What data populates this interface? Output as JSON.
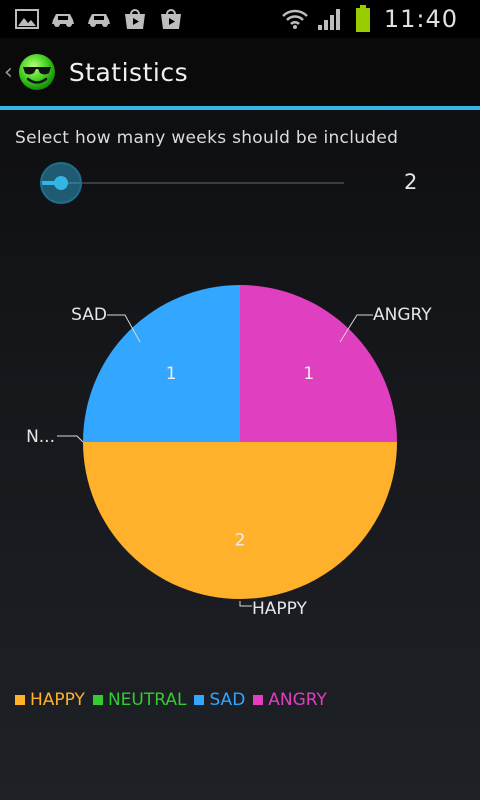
{
  "status_bar": {
    "time": "11:40",
    "icons": [
      "gallery-icon",
      "car-icon",
      "car-icon",
      "play-store-icon",
      "shop-icon",
      "wifi-icon",
      "signal-icon",
      "battery-icon"
    ]
  },
  "action_bar": {
    "title": "Statistics",
    "back_glyph": "‹"
  },
  "weeks": {
    "prompt": "Select how many weeks should be included",
    "value": "2",
    "slider_fraction": 0.07
  },
  "colors": {
    "accent": "#33b5e5",
    "happy": "#ffb12b",
    "neutral": "#33cc33",
    "sad": "#33a6ff",
    "angry": "#e03fbf"
  },
  "chart_data": {
    "type": "pie",
    "title": "",
    "slices": [
      {
        "label": "HAPPY",
        "value": 2,
        "value_label": "2",
        "color": "#ffb12b"
      },
      {
        "label": "N...",
        "value": 0,
        "value_label": "",
        "color": "#33cc33"
      },
      {
        "label": "SAD",
        "value": 1,
        "value_label": "1",
        "color": "#33a6ff"
      },
      {
        "label": "ANGRY",
        "value": 1,
        "value_label": "1",
        "color": "#e03fbf"
      }
    ],
    "legend": [
      {
        "label": "HAPPY",
        "color": "#ffb12b"
      },
      {
        "label": "NEUTRAL",
        "color": "#33cc33"
      },
      {
        "label": "SAD",
        "color": "#33a6ff"
      },
      {
        "label": "ANGRY",
        "color": "#e03fbf"
      }
    ],
    "legend_position": "bottom-left"
  }
}
